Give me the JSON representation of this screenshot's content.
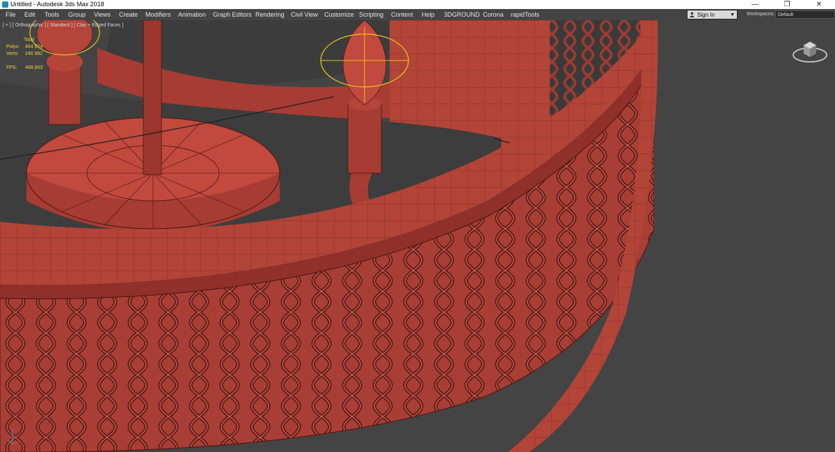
{
  "window": {
    "title": "Untitled - Autodesk 3ds Max 2018",
    "minimize": "—",
    "restore": "❐",
    "close": "✕"
  },
  "menu": {
    "items": [
      "File",
      "Edit",
      "Tools",
      "Group",
      "Views",
      "Create",
      "Modifiers",
      "Animation",
      "Graph Editors",
      "Rendering",
      "Civil View",
      "Customize",
      "Scripting",
      "Content",
      "Help",
      "3DGROUND",
      "Corona",
      "rapidTools"
    ],
    "sign_in": "Sign In",
    "workspaces_label": "Workspaces:",
    "workspaces_value": "Default"
  },
  "viewport": {
    "label": "[ + ] [ Orthographic ] [ Standard ] [ Clay + Edged Faces ]",
    "stats": {
      "total_label": "Total",
      "polys_label": "Polys:",
      "polys_value": "464 974",
      "verts_label": "Verts:",
      "verts_value": "246 982",
      "fps_label": "FPS:",
      "fps_value": "488,663"
    }
  },
  "icons": [
    "app-icon",
    "user-icon",
    "viewcube-icon",
    "axis-tripod-icon"
  ],
  "colors": {
    "clay": "#b8473d",
    "clay_dark": "#7a2520",
    "wire": "#3a0d0b",
    "selection": "#e8c21a",
    "viewport_bg": "#444444"
  }
}
